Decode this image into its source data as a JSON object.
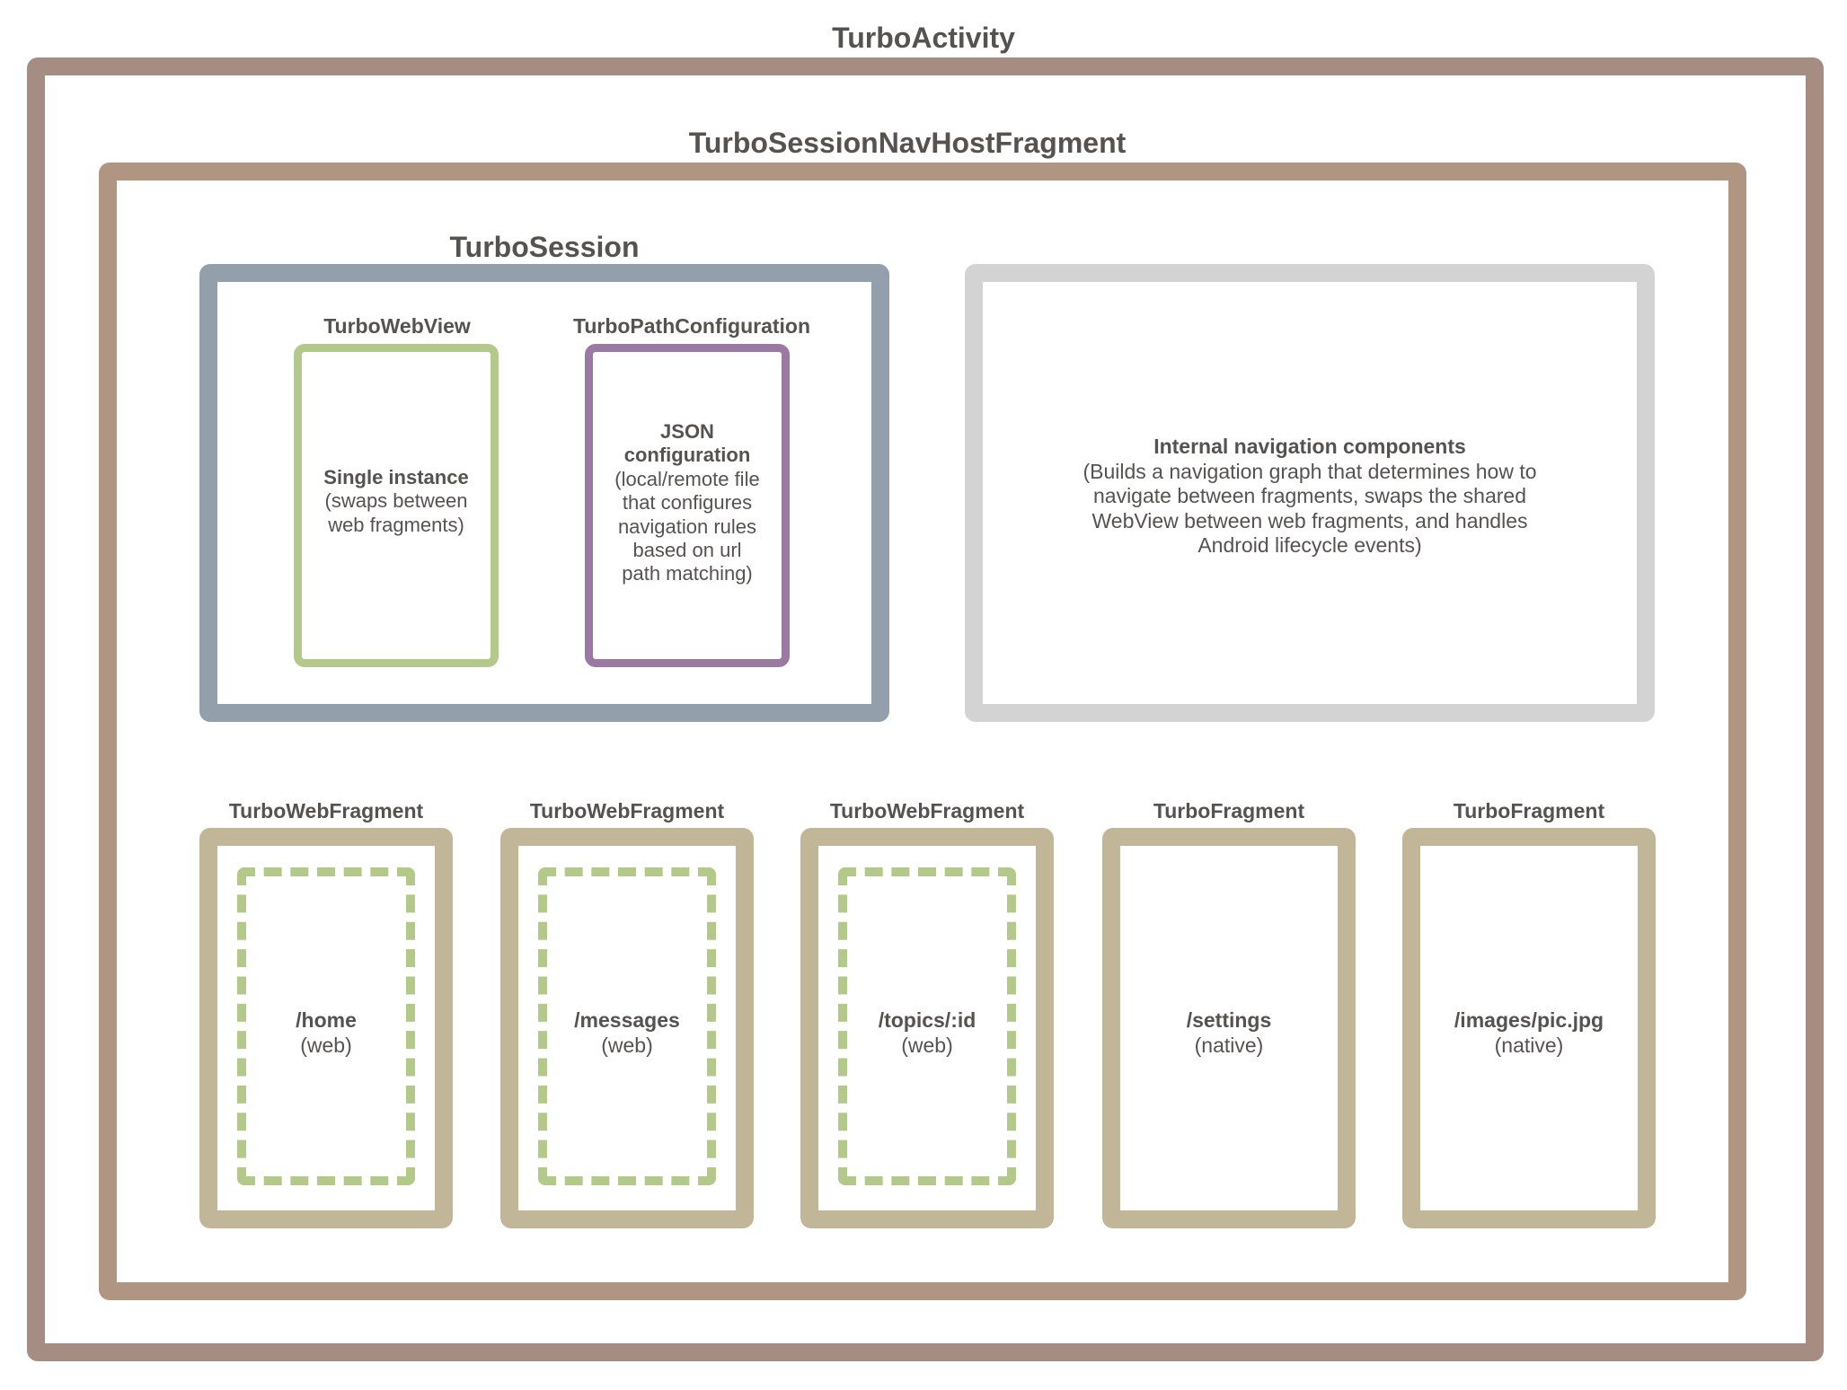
{
  "colors": {
    "activity_border": "#a58d84",
    "navhost_border": "#b09583",
    "session_border": "#939fab",
    "internal_border": "#d3d3d3",
    "webview_border": "#b3c98a",
    "pathconfig_border": "#9a79a3",
    "fragment_border": "#c2b699",
    "dashed_border": "#b3c98a",
    "text": "#555250"
  },
  "activity": {
    "title": "TurboActivity"
  },
  "navhost": {
    "title": "TurboSessionNavHostFragment"
  },
  "session": {
    "title": "TurboSession",
    "webview": {
      "title": "TurboWebView",
      "heading": "Single instance",
      "lines": [
        "(swaps between",
        "web fragments)"
      ]
    },
    "pathconfig": {
      "title": "TurboPathConfiguration",
      "heading_lines": [
        "JSON",
        "configuration"
      ],
      "lines": [
        "(local/remote file",
        "that configures",
        "navigation rules",
        "based on url",
        "path matching)"
      ]
    }
  },
  "internal": {
    "heading": "Internal navigation components",
    "lines": [
      "(Builds a navigation graph that determines how to",
      "navigate between fragments, swaps the shared",
      "WebView between web fragments, and handles",
      "Android lifecycle events)"
    ]
  },
  "fragments": [
    {
      "title": "TurboWebFragment",
      "path": "/home",
      "kind": "(web)",
      "dashed": true
    },
    {
      "title": "TurboWebFragment",
      "path": "/messages",
      "kind": "(web)",
      "dashed": true
    },
    {
      "title": "TurboWebFragment",
      "path": "/topics/:id",
      "kind": "(web)",
      "dashed": true
    },
    {
      "title": "TurboFragment",
      "path": "/settings",
      "kind": "(native)",
      "dashed": false
    },
    {
      "title": "TurboFragment",
      "path": "/images/pic.jpg",
      "kind": "(native)",
      "dashed": false
    }
  ]
}
